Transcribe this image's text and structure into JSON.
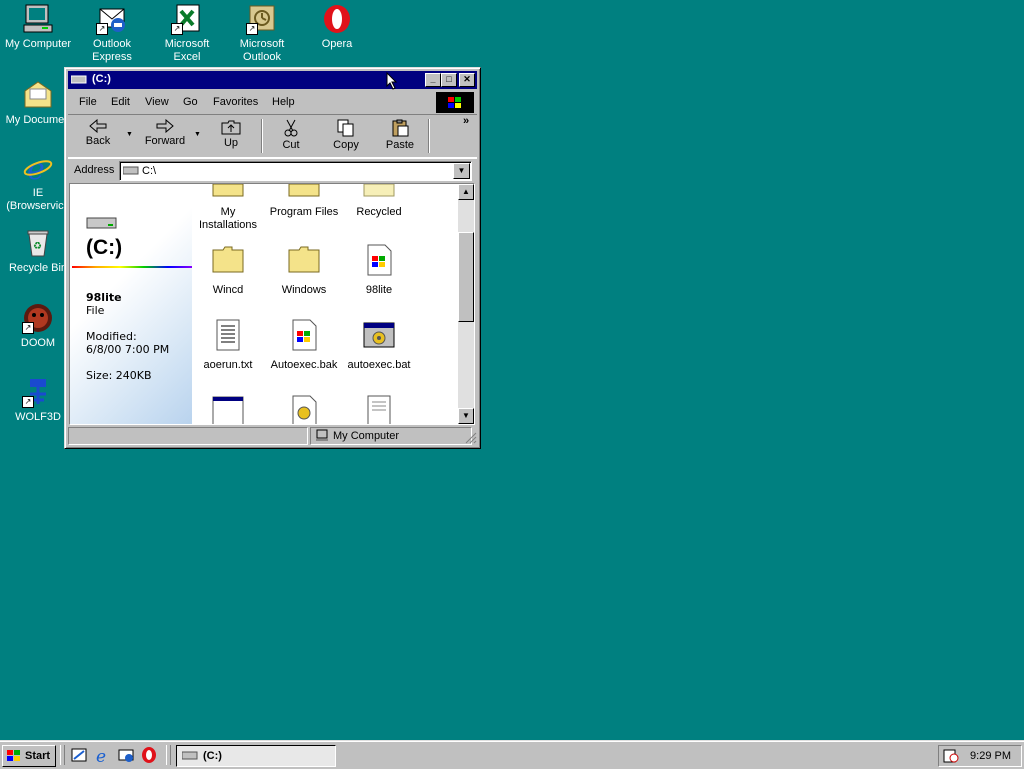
{
  "desktop": {
    "icons": [
      {
        "label": "My Computer",
        "name": "my-computer"
      },
      {
        "label": "Outlook\nExpress",
        "name": "outlook-express"
      },
      {
        "label": "Microsoft\nExcel",
        "name": "microsoft-excel"
      },
      {
        "label": "Microsoft\nOutlook",
        "name": "microsoft-outlook"
      },
      {
        "label": "Opera",
        "name": "opera"
      },
      {
        "label": "My Documen",
        "name": "my-documents"
      },
      {
        "label": "IE\n(Browservice",
        "name": "ie-browservice"
      },
      {
        "label": "Recycle Bin",
        "name": "recycle-bin"
      },
      {
        "label": "DOOM",
        "name": "doom"
      },
      {
        "label": "WOLF3D",
        "name": "wolf3d"
      }
    ]
  },
  "window": {
    "title": "(C:)",
    "menu": [
      "File",
      "Edit",
      "View",
      "Go",
      "Favorites",
      "Help"
    ],
    "toolbar": {
      "back": "Back",
      "forward": "Forward",
      "up": "Up",
      "cut": "Cut",
      "copy": "Copy",
      "paste": "Paste",
      "more": "»"
    },
    "address": {
      "label": "Address",
      "value": "C:\\"
    },
    "infopane": {
      "drive_title": "(C:)",
      "selected_name": "98lite",
      "selected_type": "File",
      "modified_label": "Modified:",
      "modified_value": "6/8/00 7:00 PM",
      "size": "Size: 240KB"
    },
    "files": [
      {
        "label": "My\nInstallations",
        "icon": "folder-icon"
      },
      {
        "label": "Program Files",
        "icon": "folder-icon"
      },
      {
        "label": "Recycled",
        "icon": "recycle-folder-icon"
      },
      {
        "label": "Wincd",
        "icon": "folder-icon"
      },
      {
        "label": "Windows",
        "icon": "folder-icon"
      },
      {
        "label": "98lite",
        "icon": "windows-app-icon"
      },
      {
        "label": "aoerun.txt",
        "icon": "text-file-icon"
      },
      {
        "label": "Autoexec.bak",
        "icon": "windows-app-icon"
      },
      {
        "label": "autoexec.bat",
        "icon": "batch-file-icon"
      }
    ],
    "status": {
      "location": "My Computer"
    }
  },
  "taskbar": {
    "start_label": "Start",
    "task_label": "(C:)",
    "clock": "9:29 PM"
  },
  "colors": {
    "desktop": "#008080",
    "titlebar": "#000080",
    "face": "#c0c0c0"
  }
}
